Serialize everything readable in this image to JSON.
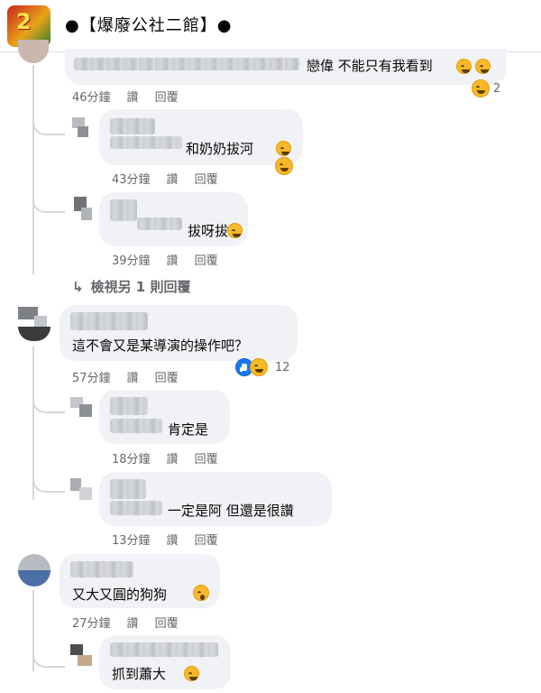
{
  "header": {
    "title": "●【爆廢公社二館】●"
  },
  "comments": [
    {
      "text": "戀偉 不能只有我看到",
      "time": "46分鐘",
      "like": "讚",
      "reply": "回覆",
      "reaction_count": "2"
    },
    {
      "text": "和奶奶拔河",
      "time": "43分鐘",
      "like": "讚",
      "reply": "回覆"
    },
    {
      "text": "拔呀拔",
      "time": "39分鐘",
      "like": "讚",
      "reply": "回覆"
    },
    {
      "text": "這不會又是某導演的操作吧？",
      "time": "57分鐘",
      "like": "讚",
      "reply": "回覆",
      "reaction_count": "12"
    },
    {
      "text": "肯定是",
      "time": "18分鐘",
      "like": "讚",
      "reply": "回覆"
    },
    {
      "text": "一定是阿 但還是很讚",
      "time": "13分鐘",
      "like": "讚",
      "reply": "回覆"
    },
    {
      "text": "又大又圓的狗狗",
      "time": "27分鐘",
      "like": "讚",
      "reply": "回覆"
    },
    {
      "text": "抓到蕭大"
    }
  ],
  "view_more": {
    "arrow": "↳",
    "label": "檢視另 1 則回覆"
  },
  "colors": {
    "bubble": "#f0f2f5",
    "meta": "#65676b",
    "thread": "#d4d6da"
  }
}
